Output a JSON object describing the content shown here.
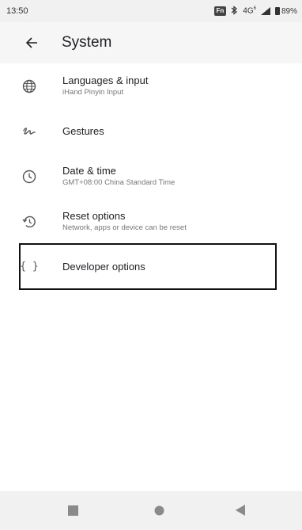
{
  "status_bar": {
    "time": "13:50",
    "fn_badge": "Fn",
    "bluetooth_icon": "bluetooth-icon",
    "network": "4G",
    "network_superscript": "6",
    "battery_percent": "89%"
  },
  "app_bar": {
    "back_icon": "arrow-left-icon",
    "title": "System"
  },
  "settings": {
    "items": [
      {
        "icon": "globe-icon",
        "title": "Languages & input",
        "subtitle": "iHand Pinyin Input"
      },
      {
        "icon": "gesture-icon",
        "title": "Gestures",
        "subtitle": ""
      },
      {
        "icon": "clock-icon",
        "title": "Date & time",
        "subtitle": "GMT+08:00 China Standard Time"
      },
      {
        "icon": "restore-icon",
        "title": "Reset options",
        "subtitle": "Network, apps or device can be reset"
      },
      {
        "icon": "braces-icon",
        "title": "Developer options",
        "subtitle": "",
        "glyph": "{ }"
      }
    ]
  },
  "nav_bar": {
    "recents_icon": "square-icon",
    "home_icon": "circle-icon",
    "back_icon": "triangle-back-icon"
  }
}
